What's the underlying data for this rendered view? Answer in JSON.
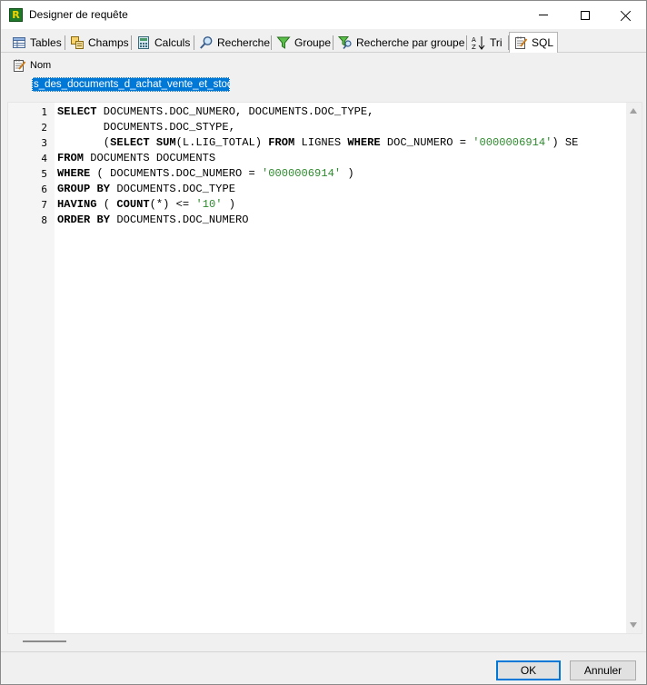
{
  "window": {
    "title": "Designer de requête",
    "app_icon_letter": "R"
  },
  "tabs": [
    {
      "label": "Tables",
      "icon": "table-icon"
    },
    {
      "label": "Champs",
      "icon": "fields-icon"
    },
    {
      "label": "Calculs",
      "icon": "calculator-icon"
    },
    {
      "label": "Recherche",
      "icon": "magnifier-icon"
    },
    {
      "label": "Groupe",
      "icon": "filter-icon"
    },
    {
      "label": "Recherche par groupe",
      "icon": "group-search-icon"
    },
    {
      "label": "Tri",
      "icon": "sort-az-icon"
    },
    {
      "label": "SQL",
      "icon": "sql-notepad-icon",
      "active": true
    }
  ],
  "name_field": {
    "label": "Nom",
    "value": "s_des_documents_d_achat_vente_et_stock"
  },
  "editor": {
    "line_numbers": [
      "1",
      "2",
      "3",
      "4",
      "5",
      "6",
      "7",
      "8"
    ],
    "lines": [
      [
        {
          "t": "SELECT",
          "k": "kw"
        },
        {
          "t": " DOCUMENTS.DOC_NUMERO, DOCUMENTS.DOC_TYPE,"
        }
      ],
      [
        {
          "t": "       DOCUMENTS.DOC_STYPE,"
        }
      ],
      [
        {
          "t": "       (",
          "k": ""
        },
        {
          "t": "SELECT",
          "k": "kw"
        },
        {
          "t": " "
        },
        {
          "t": "SUM",
          "k": "kw"
        },
        {
          "t": "(L.LIG_TOTAL) "
        },
        {
          "t": "FROM",
          "k": "kw"
        },
        {
          "t": " LIGNES "
        },
        {
          "t": "WHERE",
          "k": "kw"
        },
        {
          "t": " DOC_NUMERO = "
        },
        {
          "t": "'0000006914'",
          "k": "str"
        },
        {
          "t": ") SE"
        }
      ],
      [
        {
          "t": "FROM",
          "k": "kw"
        },
        {
          "t": " DOCUMENTS DOCUMENTS"
        }
      ],
      [
        {
          "t": "WHERE",
          "k": "kw"
        },
        {
          "t": " ( DOCUMENTS.DOC_NUMERO = "
        },
        {
          "t": "'0000006914'",
          "k": "str"
        },
        {
          "t": " )"
        }
      ],
      [
        {
          "t": "GROUP BY",
          "k": "kw"
        },
        {
          "t": " DOCUMENTS.DOC_TYPE"
        }
      ],
      [
        {
          "t": "HAVING",
          "k": "kw"
        },
        {
          "t": " ( "
        },
        {
          "t": "COUNT",
          "k": "kw"
        },
        {
          "t": "(*) <= "
        },
        {
          "t": "'10'",
          "k": "str"
        },
        {
          "t": " )"
        }
      ],
      [
        {
          "t": "ORDER BY",
          "k": "kw"
        },
        {
          "t": " DOCUMENTS.DOC_NUMERO"
        }
      ]
    ]
  },
  "buttons": {
    "ok": "OK",
    "cancel": "Annuler"
  },
  "colors": {
    "selection": "#0078d7",
    "string_literal": "#2e8b2e"
  }
}
